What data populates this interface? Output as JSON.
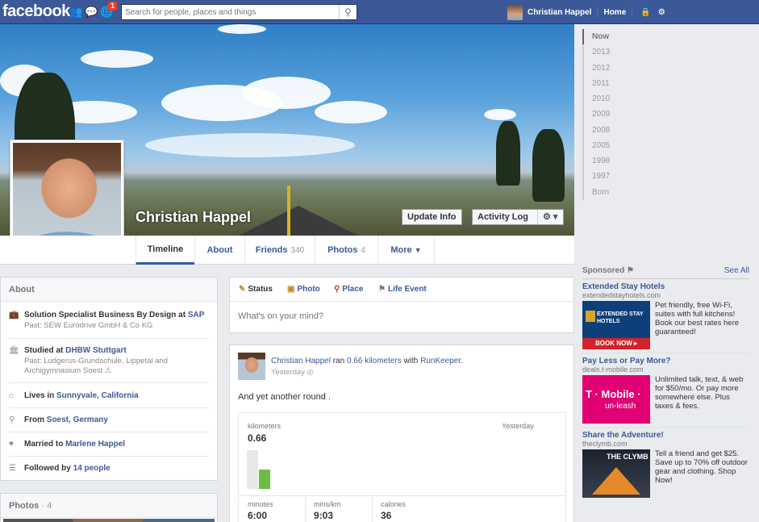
{
  "topbar": {
    "logo": "facebook",
    "notifications_count": "1",
    "search_placeholder": "Search for people, places and things",
    "user_name": "Christian Happel",
    "home_label": "Home"
  },
  "profile": {
    "name": "Christian Happel",
    "update_info_label": "Update Info",
    "activity_log_label": "Activity Log"
  },
  "tabs": [
    {
      "label": "Timeline",
      "count": ""
    },
    {
      "label": "About",
      "count": ""
    },
    {
      "label": "Friends",
      "count": "340"
    },
    {
      "label": "Photos",
      "count": "4"
    },
    {
      "label": "More",
      "count": ""
    }
  ],
  "years": [
    "Now",
    "2013",
    "2012",
    "2011",
    "2010",
    "2009",
    "2008",
    "2005",
    "1998",
    "1997",
    "Born"
  ],
  "about": {
    "title": "About",
    "work_prefix": "Solution Specialist Business By Design at ",
    "work_company": "SAP",
    "work_past": "Past: SEW Eurodrive GmbH & Co KG",
    "study_prefix": "Studied at ",
    "study_school": "DHBW Stuttgart",
    "study_past": "Past: Ludgerus-Grundschule, Lippetal and Archigymnasium Soest",
    "lives_prefix": "Lives in ",
    "lives_place": "Sunnyvale, California",
    "from_prefix": "From ",
    "from_place": "Soest, Germany",
    "married_prefix": "Married to ",
    "married_name": "Marlene Happel",
    "followed_prefix": "Followed by ",
    "followed_count": "14 people"
  },
  "photos_box": {
    "title": "Photos",
    "count": "4"
  },
  "composer": {
    "tabs": [
      "Status",
      "Photo",
      "Place",
      "Life Event"
    ],
    "placeholder": "What's on your mind?"
  },
  "post": {
    "author": "Christian Happel",
    "ran_text": " ran ",
    "distance": "0.66 kilometers",
    "with_text": " with ",
    "app": "RunKeeper.",
    "time": "Yesterday",
    "message": "And yet another round .",
    "card": {
      "metric_label": "kilometers",
      "metric_value": "0.66",
      "date_label": "Yesterday",
      "stats": [
        {
          "label": "minutes",
          "value": "6:00"
        },
        {
          "label": "mins/km",
          "value": "9:03"
        },
        {
          "label": "calories",
          "value": "36"
        }
      ]
    }
  },
  "sponsored": {
    "title": "Sponsored",
    "see_all": "See All",
    "ads": [
      {
        "title": "Extended Stay Hotels",
        "domain": "extendedstayhotels.com",
        "text": "Pet friendly, free Wi-Fi, suites with full kitchens! Book our best rates here guaranteed!",
        "img_brand": "EXTENDED STAY HOTELS",
        "img_cta": "BOOK NOW ▸",
        "color": "#0e3f7a"
      },
      {
        "title": "Pay Less or Pay More?",
        "domain": "deals.t-mobile.com",
        "text": "Unlimited talk, text, & web for $50/mo. Or pay more somewhere else. Plus taxes & fees.",
        "img_brand": "T · Mobile ·",
        "img_cta": "un-leash",
        "color": "#e20074"
      },
      {
        "title": "Share the Adventure!",
        "domain": "theclymb.com",
        "text": "Tell a friend and get $25. Save up to 70% off outdoor gear and clothing. Shop Now!",
        "img_brand": "THE CLYMB",
        "img_cta": "",
        "color": "#2a2f3b"
      }
    ]
  }
}
